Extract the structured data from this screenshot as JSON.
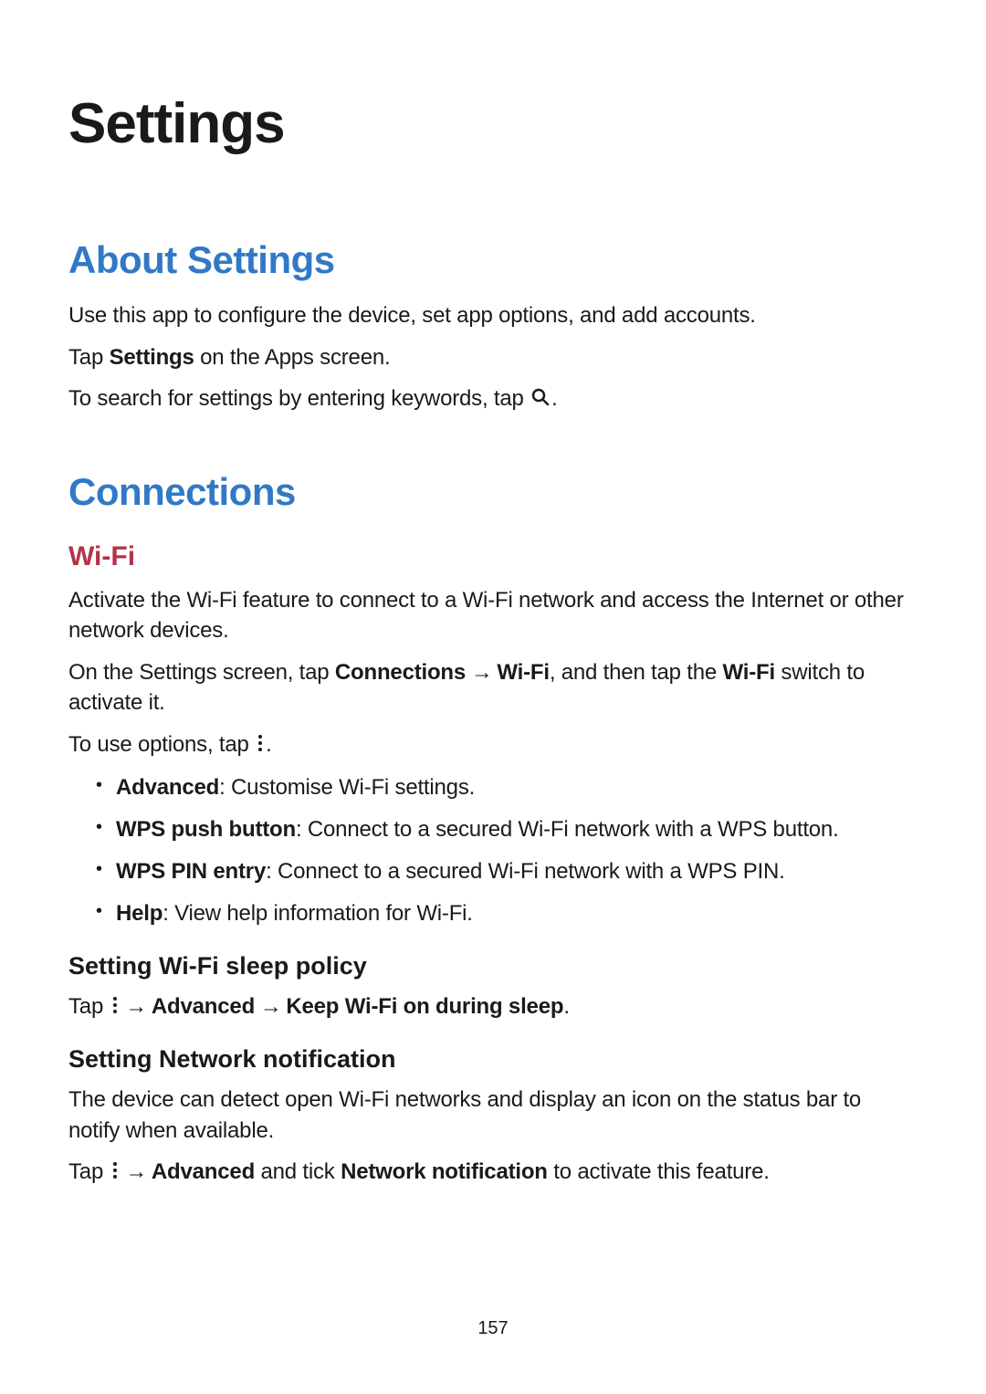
{
  "title": "Settings",
  "about": {
    "heading": "About Settings",
    "p1": "Use this app to configure the device, set app options, and add accounts.",
    "p2_pre": "Tap ",
    "p2_bold": "Settings",
    "p2_post": " on the Apps screen.",
    "p3_pre": "To search for settings by entering keywords, tap ",
    "p3_post": "."
  },
  "connections": {
    "heading": "Connections",
    "wifi": {
      "heading": "Wi-Fi",
      "p1": "Activate the Wi-Fi feature to connect to a Wi-Fi network and access the Internet or other network devices.",
      "p2_pre": "On the Settings screen, tap ",
      "p2_b1": "Connections",
      "p2_arrow": " → ",
      "p2_b2": "Wi-Fi",
      "p2_mid": ", and then tap the ",
      "p2_b3": "Wi-Fi",
      "p2_post": " switch to activate it.",
      "p3_pre": "To use options, tap ",
      "p3_post": ".",
      "bullets": [
        {
          "bold": "Advanced",
          "text": ": Customise Wi-Fi settings."
        },
        {
          "bold": "WPS push button",
          "text": ": Connect to a secured Wi-Fi network with a WPS button."
        },
        {
          "bold": "WPS PIN entry",
          "text": ": Connect to a secured Wi-Fi network with a WPS PIN."
        },
        {
          "bold": "Help",
          "text": ": View help information for Wi-Fi."
        }
      ],
      "sleep": {
        "heading": "Setting Wi-Fi sleep policy",
        "p1_pre": "Tap ",
        "p1_arrow1": " → ",
        "p1_b1": "Advanced",
        "p1_arrow2": " → ",
        "p1_b2": "Keep Wi-Fi on during sleep",
        "p1_post": "."
      },
      "notify": {
        "heading": "Setting Network notification",
        "p1": "The device can detect open Wi-Fi networks and display an icon on the status bar to notify when available.",
        "p2_pre": "Tap ",
        "p2_arrow": " → ",
        "p2_b1": "Advanced",
        "p2_mid": " and tick ",
        "p2_b2": "Network notification",
        "p2_post": " to activate this feature."
      }
    }
  },
  "page_number": "157"
}
